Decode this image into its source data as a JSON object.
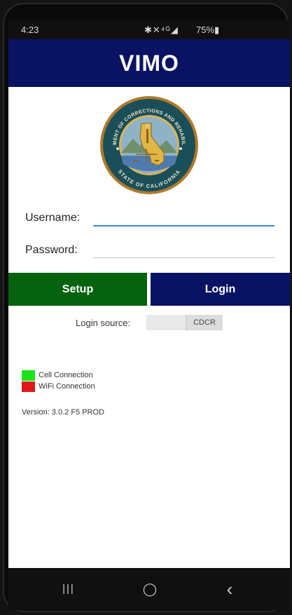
{
  "status_bar": {
    "time": "4:23",
    "icons": "✱✕⁴ᴳ◢",
    "battery": "75%▮"
  },
  "app": {
    "title": "VIMO"
  },
  "seal": {
    "top_text": "DEPARTMENT OF CORRECTIONS AND REHABILITATION",
    "bottom_text": "STATE OF CALIFORNIA"
  },
  "form": {
    "username_label": "Username:",
    "username_value": "",
    "password_label": "Password:",
    "password_value": ""
  },
  "buttons": {
    "setup": "Setup",
    "login": "Login"
  },
  "login_source": {
    "label": "Login source:",
    "value": "CDCR"
  },
  "legend": [
    {
      "label": "Cell Connection",
      "color": "#19e619"
    },
    {
      "label": "WiFi Connection",
      "color": "#e01818"
    }
  ],
  "version": "Version:  3.0.2  F5 PROD",
  "nav": {
    "recent": "|||",
    "home": "◯",
    "back": "‹"
  },
  "colors": {
    "header": "#0a1264",
    "setup": "#06620f",
    "login": "#0a1264",
    "focus_line": "#3b8fd6"
  }
}
